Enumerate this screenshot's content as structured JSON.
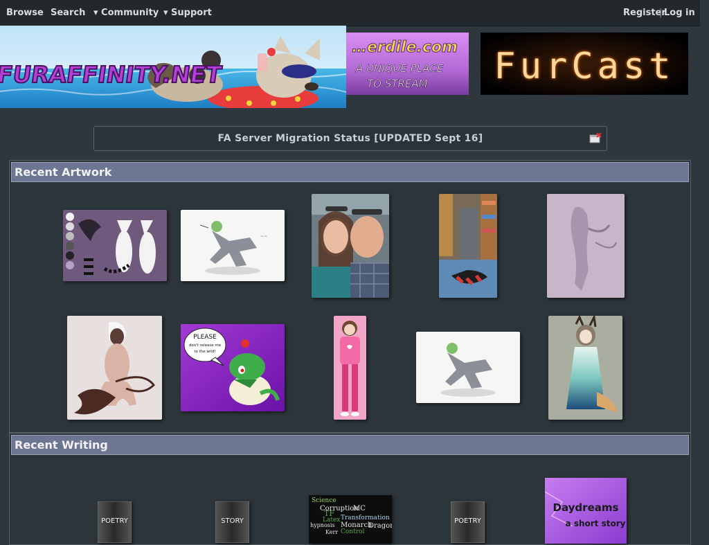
{
  "nav": {
    "browse": "Browse",
    "search": "Search",
    "community": "▾ Community",
    "support": "▾ Support",
    "register": "Register",
    "separator": "|",
    "login": "Log in"
  },
  "banners": {
    "main_logo": "FURAFFINITY.NET",
    "ad1_title": "…erdile.com",
    "ad1_line1": "A UNIQUE PLACE",
    "ad1_line2": "TO STREAM",
    "ad2_title": "FurCast"
  },
  "notice": {
    "text": "FA Server Migration Status [UPDATED Sept 16]"
  },
  "sections": {
    "artwork_title": "Recent Artwork",
    "writing_title": "Recent Writing"
  },
  "artwork_thumbs": {
    "please_text_1": "PLEASE",
    "please_text_2": "don't release me",
    "please_text_3": "to the wild!"
  },
  "writing_thumbs": {
    "poetry1": "POETRY",
    "story": "STORY",
    "poetry2": "POETRY",
    "wordcloud_words": [
      "Science",
      "Corruption",
      "MC",
      "TF",
      "Latex",
      "Transformation",
      "hypnosis",
      "Monarch",
      "Dragon",
      "Control",
      "Kerr"
    ],
    "daydreams_title": "Daydreams",
    "daydreams_sub": "a short story"
  },
  "colors": {
    "page_bg": "#2e373d",
    "nav_bg": "#22282c",
    "section_header": "#6c7591"
  }
}
